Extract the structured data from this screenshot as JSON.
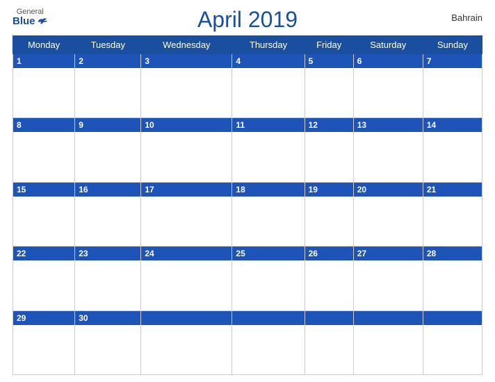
{
  "logo": {
    "general": "General",
    "blue": "Blue"
  },
  "title": "April 2019",
  "country": "Bahrain",
  "weekdays": [
    "Monday",
    "Tuesday",
    "Wednesday",
    "Thursday",
    "Friday",
    "Saturday",
    "Sunday"
  ],
  "weeks": [
    [
      1,
      2,
      3,
      4,
      5,
      6,
      7
    ],
    [
      8,
      9,
      10,
      11,
      12,
      13,
      14
    ],
    [
      15,
      16,
      17,
      18,
      19,
      20,
      21
    ],
    [
      22,
      23,
      24,
      25,
      26,
      27,
      28
    ],
    [
      29,
      30,
      null,
      null,
      null,
      null,
      null
    ]
  ],
  "colors": {
    "header_bg": "#1e54b7",
    "accent": "#1a4fa0",
    "white": "#ffffff",
    "border": "#cccccc"
  }
}
